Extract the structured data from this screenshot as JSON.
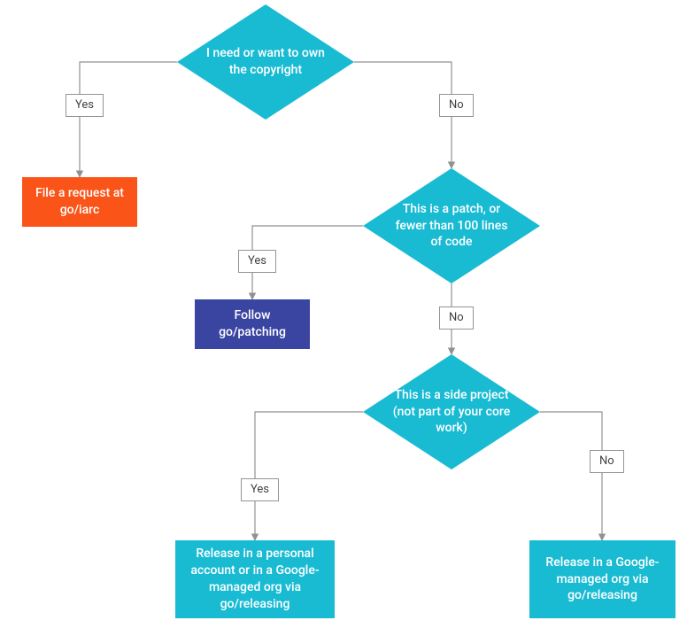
{
  "colors": {
    "decision": "#19bbd3",
    "orange": "#fa5419",
    "blue": "#3a44a1",
    "arrow": "#919191",
    "labelBorder": "#949494",
    "labelText": "#424242"
  },
  "nodes": {
    "d1": "I need or want to own the copyright",
    "d2": "This is a patch, or fewer than 100 lines of code",
    "d3": "This is a side project (not part of your core work)",
    "r_iarc": "File a request at go/iarc",
    "r_patch": "Follow go/patching",
    "r_personal": "Release in a personal account or in a Google-managed org via go/releasing",
    "r_managed": "Release in a Google-managed org via go/releasing"
  },
  "edgeLabels": {
    "yes": "Yes",
    "no": "No"
  }
}
